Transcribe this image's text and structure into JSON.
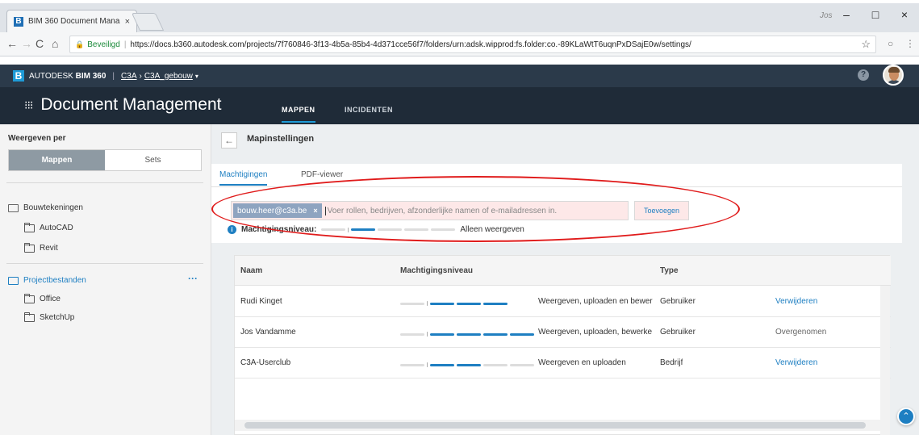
{
  "browser": {
    "tab_title": "BIM 360 Document Mana",
    "tab_close": "×",
    "profile": "Jos",
    "win_min": "–",
    "win_max": "□",
    "win_close": "×",
    "secure_label": "Beveiligd",
    "url": "https://docs.b360.autodesk.com/projects/7f760846-3f13-4b5a-85b4-4d371cce56f7/folders/urn:adsk.wipprod:fs.folder:co.-89KLaWtT6uqnPxDSajE0w/settings/"
  },
  "header": {
    "brand_prefix": "AUTODESK",
    "brand_name": "BIM 360",
    "crumb_project": "C3A",
    "crumb_sep": "›",
    "crumb_building": "C3A_gebouw",
    "help": "?"
  },
  "module": {
    "title": "Document Management",
    "tabs": [
      {
        "label": "MAPPEN",
        "active": true
      },
      {
        "label": "INCIDENTEN",
        "active": false
      }
    ]
  },
  "sidebar": {
    "heading": "Weergeven per",
    "view_options": [
      "Mappen",
      "Sets"
    ],
    "tree": [
      {
        "label": "Bouwtekeningen",
        "level": 0
      },
      {
        "label": "AutoCAD",
        "level": 1
      },
      {
        "label": "Revit",
        "level": 1
      },
      {
        "label": "Projectbestanden",
        "level": 0,
        "active": true
      },
      {
        "label": "Office",
        "level": 1
      },
      {
        "label": "SketchUp",
        "level": 1
      }
    ],
    "more": "···"
  },
  "settings": {
    "back": "←",
    "title": "Mapinstellingen",
    "tabs": [
      "Machtigingen",
      "PDF-viewer"
    ],
    "chip": "bouw.heer@c3a.be",
    "chip_remove": "×",
    "input_placeholder": "Voer rollen, bedrijven, afzonderlijke namen of e-mailadressen in.",
    "add_button": "Toevoegen",
    "level_label": "Machtigingsniveau:",
    "level_value": "Alleen weergeven",
    "level_steps_active": 1
  },
  "table": {
    "headers": [
      "Naam",
      "Machtigingsniveau",
      "Type"
    ],
    "rows": [
      {
        "name": "Rudi Kinget",
        "level": "Weergeven, uploaden en bewer",
        "level_steps": 3,
        "type": "Gebruiker",
        "action": "Verwijderen",
        "action_link": true
      },
      {
        "name": "Jos Vandamme",
        "level": "Weergeven, uploaden, bewerke",
        "level_steps": 4,
        "type": "Gebruiker",
        "action": "Overgenomen",
        "action_link": false
      },
      {
        "name": "C3A-Userclub",
        "level": "Weergeven en uploaden",
        "level_steps": 2,
        "type": "Bedrijf",
        "action": "Verwijderen",
        "action_link": true
      }
    ]
  },
  "colors": {
    "accent": "#1e7fc2",
    "header_bg": "#2b3a4a",
    "module_bg": "#1f2b38",
    "annotation_red": "#e01b1b"
  }
}
